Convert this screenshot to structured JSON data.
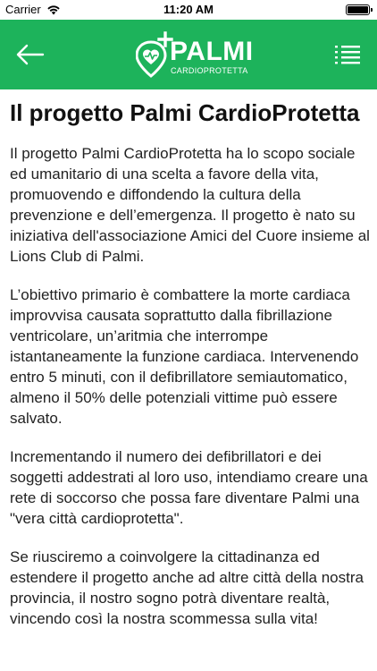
{
  "status_bar": {
    "carrier": "Carrier",
    "time": "11:20 AM",
    "wifi_icon": "wifi-icon",
    "battery_icon": "battery-icon"
  },
  "nav": {
    "background": "#1db35b",
    "back_icon": "arrow-left-icon",
    "menu_icon": "list-menu-icon",
    "logo": {
      "title": "PALMI",
      "subtitle": "CARDIOPROTETTA",
      "icon": "heart-pin-plus-icon"
    }
  },
  "article": {
    "title": "Il progetto Palmi CardioProtetta",
    "paragraphs": [
      "Il progetto Palmi CardioProtetta ha lo scopo sociale ed umanitario di una scelta a favore della vita, promuovendo e diffondendo la cultura della prevenzione e dell’emergenza. Il progetto è nato su iniziativa dell'associazione Amici del Cuore insieme al Lions Club di Palmi.",
      "L’obiettivo primario è combattere la morte cardiaca improvvisa causata soprattutto dalla fibrillazione ventricolare, un’aritmia che interrompe istantaneamente la funzione cardiaca. Intervenendo entro 5 minuti, con il defibrillatore semiautomatico, almeno il 50% delle potenziali vittime può essere salvato.",
      "Incrementando il numero dei defibrillatori e dei soggetti addestrati al loro uso, intendiamo creare una rete di soccorso che possa fare diventare Palmi una \"vera città cardioprotetta\".",
      "Se riusciremo a coinvolgere la cittadinanza ed estendere il progetto anche ad altre città della nostra provincia, il nostro sogno potrà diventare realtà, vincendo così la nostra scommessa sulla vita!"
    ]
  }
}
